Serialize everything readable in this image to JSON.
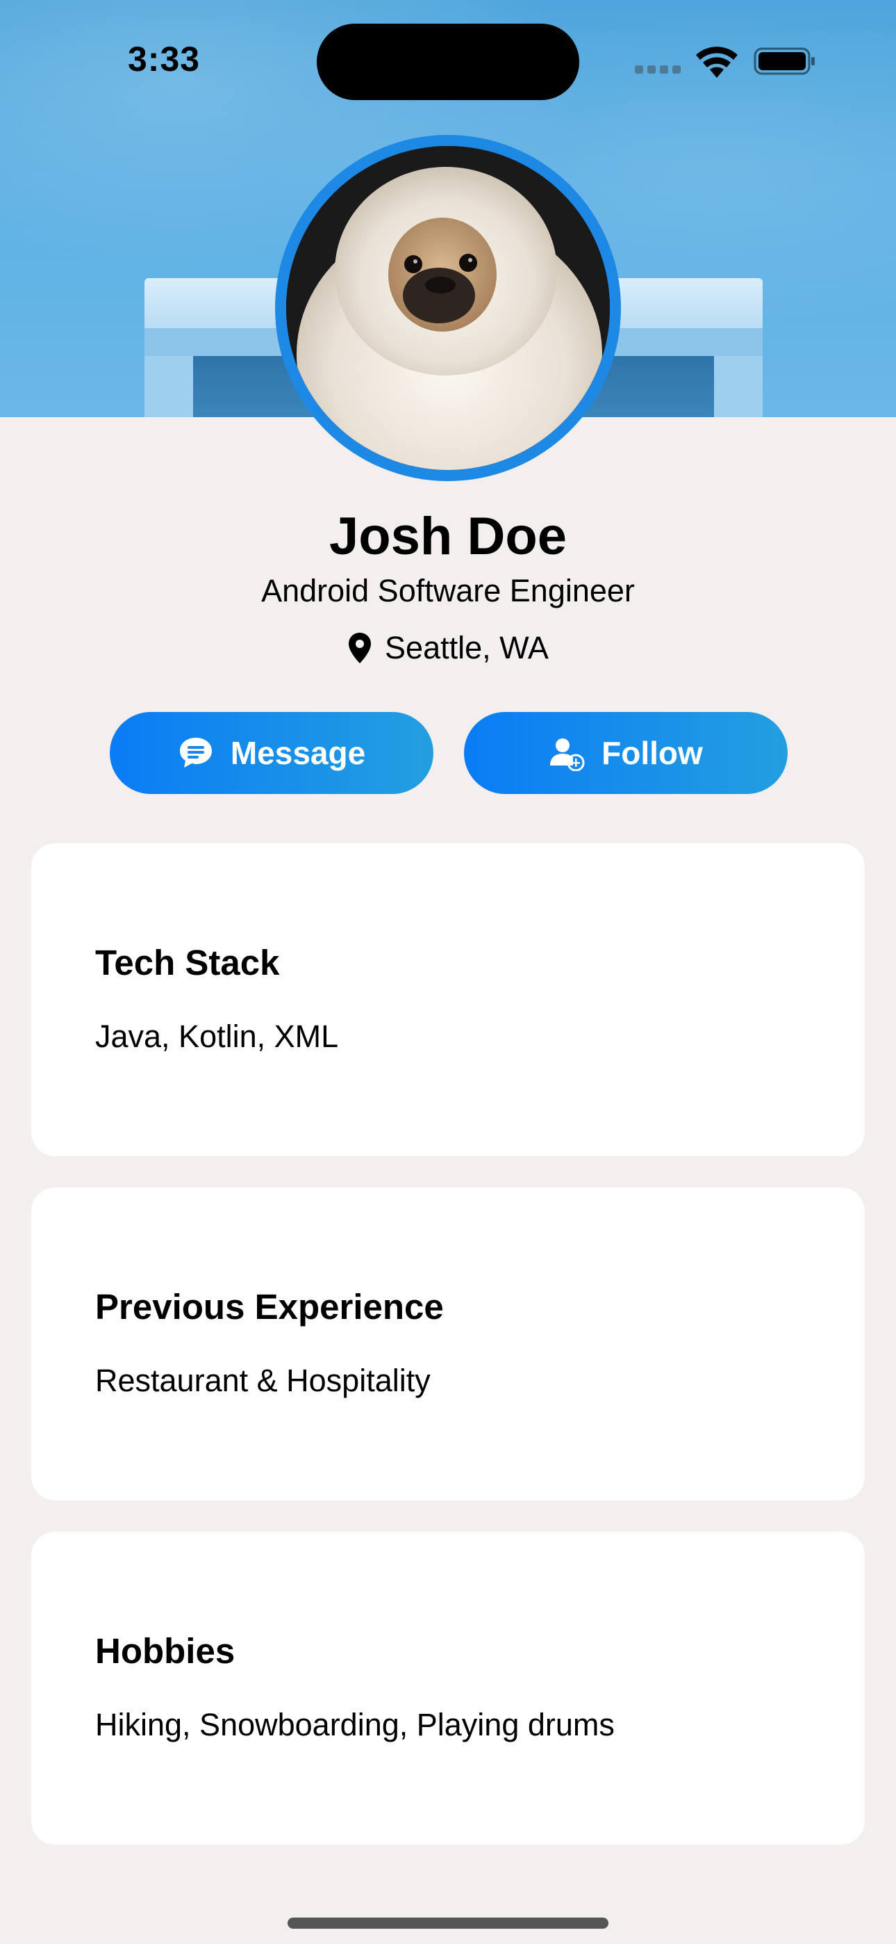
{
  "status_bar": {
    "time": "3:33"
  },
  "profile": {
    "name": "Josh Doe",
    "title": "Android Software Engineer",
    "location": "Seattle, WA"
  },
  "actions": {
    "message_label": "Message",
    "follow_label": "Follow"
  },
  "cards": [
    {
      "heading": "Tech Stack",
      "body": "Java, Kotlin, XML"
    },
    {
      "heading": "Previous Experience",
      "body": "Restaurant & Hospitality"
    },
    {
      "heading": "Hobbies",
      "body": "Hiking, Snowboarding, Playing drums"
    }
  ],
  "icons": {
    "location": "location-pin-icon",
    "message": "chat-bubble-icon",
    "follow": "person-add-icon",
    "wifi": "wifi-icon",
    "battery": "battery-icon"
  },
  "colors": {
    "accent": "#1e88e5",
    "button_gradient_start": "#0a7cf5",
    "button_gradient_end": "#239fe0",
    "background": "#f2efee",
    "card": "#ffffff"
  }
}
